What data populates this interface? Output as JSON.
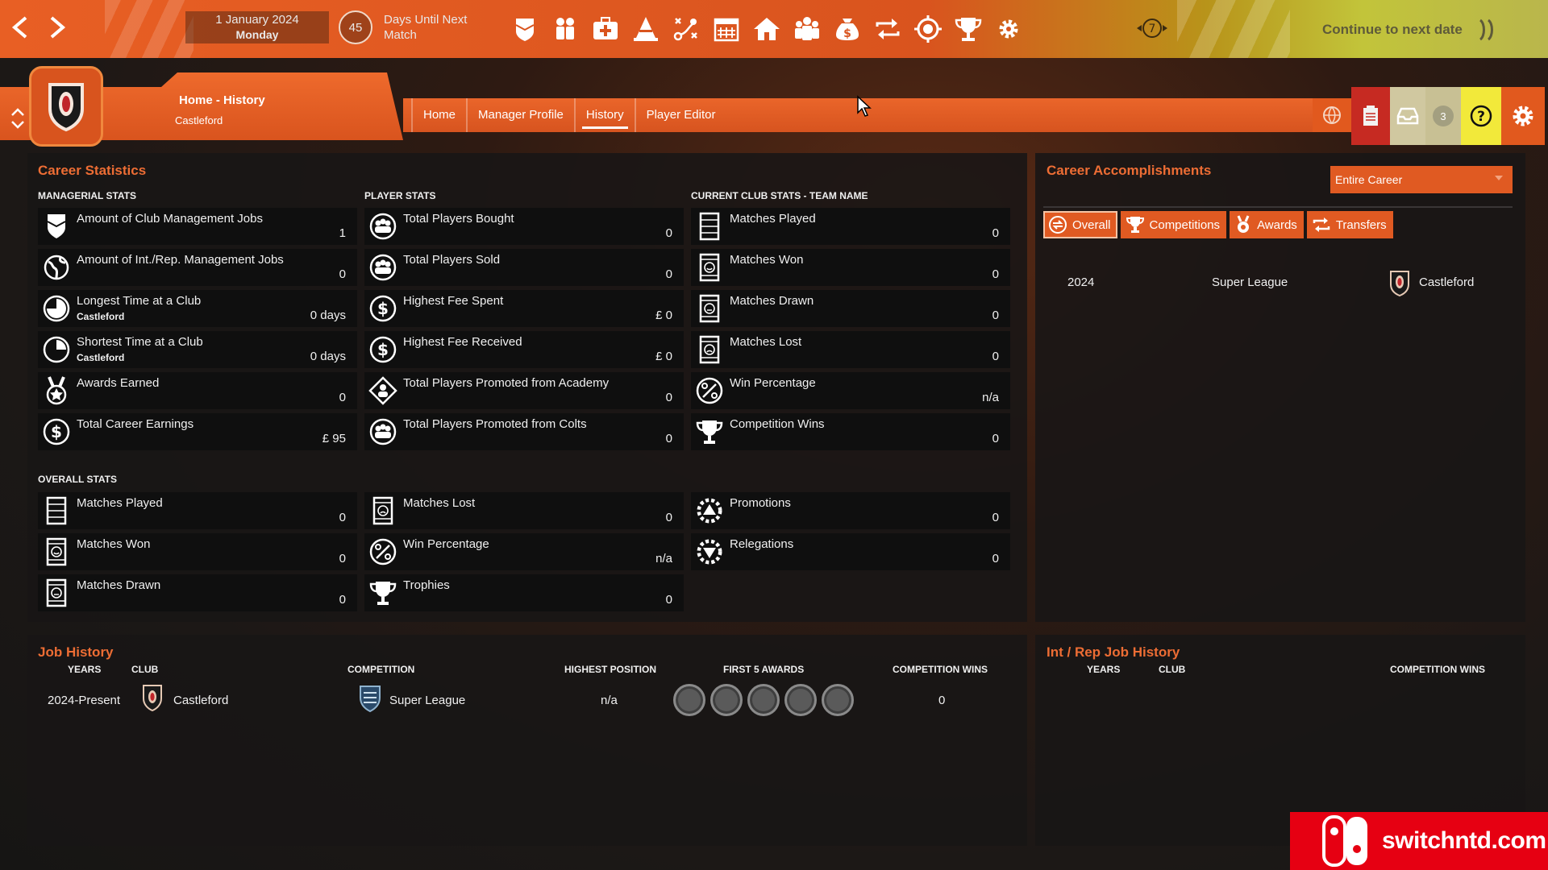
{
  "colors": {
    "accent": "#e05a22",
    "panel_title": "#ed6d34",
    "topbar": "#e85f24",
    "help": "#f2e93a"
  },
  "topbar": {
    "date": "1 January 2024",
    "weekday": "Monday",
    "days_until": "45",
    "days_until_label": "Days Until Next Match",
    "flow_badge": "7",
    "continue_label": "Continue to next date",
    "icons": [
      "shield-icon",
      "squad-icon",
      "medical-icon",
      "training-icon",
      "tactics-icon",
      "calendar-icon",
      "home-icon",
      "staff-icon",
      "finance-icon",
      "transfers-icon",
      "scouting-icon",
      "trophy-icon",
      "settings-cog-icon"
    ]
  },
  "header": {
    "breadcrumb": "Home - History",
    "club": "Castleford",
    "tabs": [
      {
        "label": "Home"
      },
      {
        "label": "Manager Profile"
      },
      {
        "label": "History"
      },
      {
        "label": "Player Editor"
      }
    ],
    "inbox_count": "3"
  },
  "career_statistics": {
    "title": "Career Statistics",
    "managerial": {
      "label": "MANAGERIAL STATS",
      "items": [
        {
          "label": "Amount of Club Management Jobs",
          "sub": "",
          "value": "1",
          "icon": "shield-icon"
        },
        {
          "label": "Amount of Int./Rep. Management Jobs",
          "sub": "",
          "value": "0",
          "icon": "globe-icon"
        },
        {
          "label": "Longest Time at a Club",
          "sub": "Castleford",
          "value": "0 days",
          "icon": "clock-icon"
        },
        {
          "label": "Shortest Time at a Club",
          "sub": "Castleford",
          "value": "0 days",
          "icon": "clock-icon"
        },
        {
          "label": "Awards Earned",
          "sub": "",
          "value": "0",
          "icon": "medal-icon"
        },
        {
          "label": "Total Career Earnings",
          "sub": "",
          "value": "£ 95",
          "icon": "money-icon"
        }
      ]
    },
    "player": {
      "label": "PLAYER STATS",
      "items": [
        {
          "label": "Total Players Bought",
          "value": "0",
          "icon": "players-icon"
        },
        {
          "label": "Total Players Sold",
          "value": "0",
          "icon": "players-icon"
        },
        {
          "label": "Highest Fee Spent",
          "value": "£ 0",
          "icon": "money-icon"
        },
        {
          "label": "Highest Fee Received",
          "value": "£ 0",
          "icon": "money-icon"
        },
        {
          "label": "Total Players Promoted from Academy",
          "value": "0",
          "icon": "academy-icon"
        },
        {
          "label": "Total Players Promoted from Colts",
          "value": "0",
          "icon": "players-icon"
        }
      ]
    },
    "current_club": {
      "label": "CURRENT CLUB STATS - TEAM NAME",
      "items": [
        {
          "label": "Matches Played",
          "value": "0",
          "icon": "pitch-icon"
        },
        {
          "label": "Matches Won",
          "value": "0",
          "icon": "match-won-icon"
        },
        {
          "label": "Matches Drawn",
          "value": "0",
          "icon": "match-drawn-icon"
        },
        {
          "label": "Matches Lost",
          "value": "0",
          "icon": "match-lost-icon"
        },
        {
          "label": "Win Percentage",
          "value": "n/a",
          "icon": "percent-icon"
        },
        {
          "label": "Competition Wins",
          "value": "0",
          "icon": "trophy-icon"
        }
      ]
    },
    "overall": {
      "label": "OVERALL STATS",
      "items": [
        {
          "label": "Matches Played",
          "value": "0",
          "icon": "pitch-icon"
        },
        {
          "label": "Matches Won",
          "value": "0",
          "icon": "match-won-icon"
        },
        {
          "label": "Matches Drawn",
          "value": "0",
          "icon": "match-drawn-icon"
        },
        {
          "label": "Matches Lost",
          "value": "0",
          "icon": "match-lost-icon"
        },
        {
          "label": "Win Percentage",
          "value": "n/a",
          "icon": "percent-icon"
        },
        {
          "label": "Trophies",
          "value": "0",
          "icon": "trophy-icon"
        },
        {
          "label": "Promotions",
          "value": "0",
          "icon": "promotion-icon"
        },
        {
          "label": "Relegations",
          "value": "0",
          "icon": "relegation-icon"
        }
      ]
    }
  },
  "accomplishments": {
    "title": "Career Accomplishments",
    "filter": "Entire Career",
    "tabs": [
      {
        "label": "Overall",
        "icon": "refresh-icon"
      },
      {
        "label": "Competitions",
        "icon": "trophy-icon"
      },
      {
        "label": "Awards",
        "icon": "medal-icon"
      },
      {
        "label": "Transfers",
        "icon": "transfers-icon"
      }
    ],
    "rows": [
      {
        "year": "2024",
        "competition": "Super League",
        "club": "Castleford"
      }
    ]
  },
  "job_history": {
    "title": "Job History",
    "columns": [
      "YEARS",
      "CLUB",
      "COMPETITION",
      "HIGHEST POSITION",
      "FIRST 5 AWARDS",
      "COMPETITION WINS"
    ],
    "rows": [
      {
        "years": "2024-Present",
        "club": "Castleford",
        "competition": "Super League",
        "highest_position": "n/a",
        "competition_wins": "0"
      }
    ]
  },
  "int_rep_history": {
    "title": "Int / Rep Job History",
    "columns": [
      "YEARS",
      "CLUB",
      "COMPETITION WINS"
    ]
  },
  "watermark": {
    "text": "switchntd.com"
  }
}
